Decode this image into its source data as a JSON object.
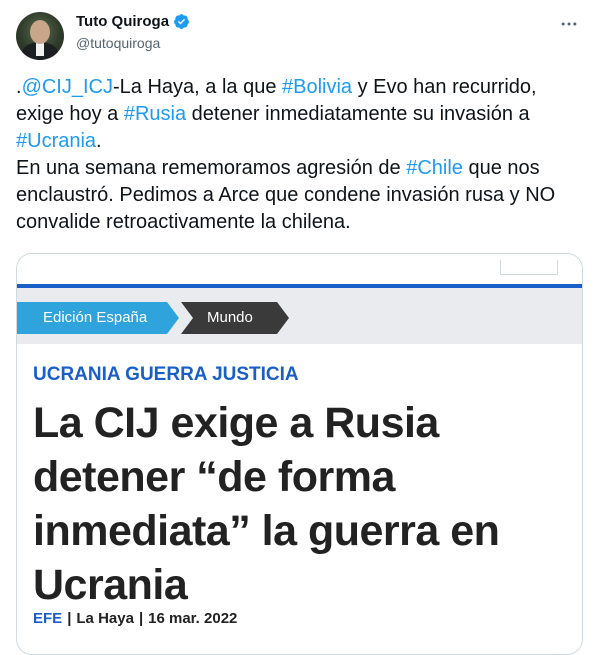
{
  "author": {
    "display_name": "Tuto Quiroga",
    "handle": "@tutoquiroga",
    "verified": true
  },
  "tweet": {
    "segments": [
      {
        "text": ".",
        "link": false
      },
      {
        "text": "@CIJ_ICJ",
        "link": true
      },
      {
        "text": "-La Haya, a la que ",
        "link": false
      },
      {
        "text": "#Bolivia",
        "link": true
      },
      {
        "text": " y Evo han recurrido, exige hoy a ",
        "link": false
      },
      {
        "text": "#Rusia",
        "link": true
      },
      {
        "text": " detener inmediatamente su invasión a ",
        "link": false
      },
      {
        "text": "#Ucrania",
        "link": true
      },
      {
        "text": ".\nEn una semana rememoramos agresión de ",
        "link": false
      },
      {
        "text": "#Chile",
        "link": true
      },
      {
        "text": " que nos enclaustró. Pedimos a Arce que condene invasión rusa y NO convalide retroactivamente la chilena.",
        "link": false
      }
    ]
  },
  "card": {
    "edition_label": "Edición España",
    "section_label": "Mundo",
    "kicker": "UCRANIA GUERRA JUSTICIA",
    "headline": "La CIJ exige a Rusia detener “de forma inmediata” la guerra en Ucrania",
    "byline_source": "EFE",
    "byline_place": "La Haya",
    "byline_date": "16 mar. 2022"
  },
  "icons": {
    "more": "more-icon",
    "verified": "verified-badge-icon",
    "avatar": "avatar"
  },
  "colors": {
    "link": "#1d9bf0",
    "news_blue": "#1a5fc8",
    "edition_tab": "#2fa4dc",
    "section_tab": "#3a3a3a"
  }
}
